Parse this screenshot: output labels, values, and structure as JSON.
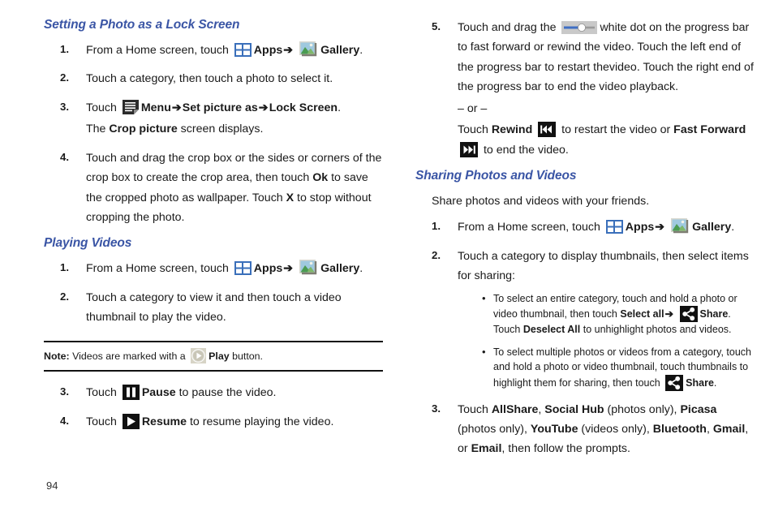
{
  "document": {
    "page_number": "94",
    "accent_heading_color": "#3a55a5"
  },
  "left_column": {
    "heading_lock_screen": "Setting a Photo as a Lock Screen",
    "lock_steps": {
      "s1": {
        "num": "1.",
        "t1": "From a Home screen, touch",
        "apps": "Apps",
        "arrow": "➔",
        "gallery": "Gallery",
        "end": "."
      },
      "s2": {
        "num": "2.",
        "text": "Touch a category, then touch a photo to select it."
      },
      "s3": {
        "num": "3.",
        "t1": "Touch",
        "menu": "Menu",
        "arrow1": "➔",
        "setpic": "Set picture as",
        "arrow2": "➔",
        "lockscreen": "Lock Screen",
        "end": ".",
        "sub_pre": "The ",
        "sub_bold": "Crop picture",
        "sub_post": " screen displays."
      },
      "s4": {
        "num": "4.",
        "t1": "Touch and drag the crop box or the sides or corners of the crop box to create the crop area, then touch ",
        "ok": "Ok",
        "t2": " to save the cropped photo as wallpaper. Touch ",
        "x": "X",
        "t3": " to stop without cropping the photo."
      }
    },
    "heading_playing_videos": "Playing Videos",
    "video_steps": {
      "s1": {
        "num": "1.",
        "t1": "From a Home screen, touch",
        "apps": "Apps",
        "arrow": "➔",
        "gallery": "Gallery",
        "end": "."
      },
      "s2": {
        "num": "2.",
        "text": "Touch a category to view it and then touch a video thumbnail to play the video."
      },
      "s3": {
        "num": "3.",
        "t1": "Touch",
        "bold": "Pause",
        "t2": " to pause the video."
      },
      "s4": {
        "num": "4.",
        "t1": "Touch",
        "bold": "Resume",
        "t2": " to resume playing the video."
      }
    },
    "note": {
      "label": "Note:",
      "t1": " Videos are marked with a",
      "bold": "Play",
      "t2": " button."
    }
  },
  "right_column": {
    "step5": {
      "num": "5.",
      "t1": "Touch and drag the",
      "t2": "white dot on the progress bar to fast forward or rewind the video. Touch the left end of the progress bar to restart thevideo. Touch the right end of the progress bar to end the video playback.",
      "or": "– or –",
      "t3": "Touch ",
      "rewind": "Rewind",
      "t4": " to restart the video or ",
      "fastforward": "Fast Forward",
      "t5": " to end the video."
    },
    "heading_sharing": "Sharing Photos and Videos",
    "intro": "Share photos and videos with your friends.",
    "share_steps": {
      "s1": {
        "num": "1.",
        "t1": "From a Home screen, touch",
        "apps": "Apps",
        "arrow": "➔",
        "gallery": "Gallery",
        "end": "."
      },
      "s2": {
        "num": "2.",
        "text": "Touch a category to display thumbnails, then select items for sharing:",
        "bullet1": {
          "t1": "To select an entire category, touch and hold a photo or video thumbnail, then touch ",
          "selectall": "Select all",
          "arrow": "➔",
          "share": "Share",
          "t2": ". Touch ",
          "deselectall": "Deselect All",
          "t3": " to unhighlight photos and videos."
        },
        "bullet2": {
          "t1": "To select multiple photos or videos from a category, touch and hold a photo or video thumbnail, touch thumbnails to highlight them for sharing, then touch ",
          "share": "Share",
          "t2": "."
        }
      },
      "s3": {
        "num": "3.",
        "t1": "Touch ",
        "allshare": "AllShare",
        "c1": ", ",
        "socialhub": "Social Hub",
        "p1": " (photos only), ",
        "picasa": "Picasa",
        "p2": " (photos only), ",
        "youtube": "YouTube",
        "p3": " (videos only), ",
        "bluetooth": "Bluetooth",
        "c2": ", ",
        "gmail": "Gmail",
        "c3": ", or ",
        "email": "Email",
        "t2": ", then follow the prompts."
      }
    }
  },
  "icons": {
    "apps": "apps-grid-icon",
    "gallery": "gallery-photo-icon",
    "menu": "menu-list-icon",
    "play": "play-circle-icon",
    "pause": "pause-icon",
    "resume": "resume-play-icon",
    "progress": "progress-slider-icon",
    "rewind": "rewind-icon",
    "fast_forward": "fast-forward-icon",
    "share": "share-nodes-icon"
  }
}
